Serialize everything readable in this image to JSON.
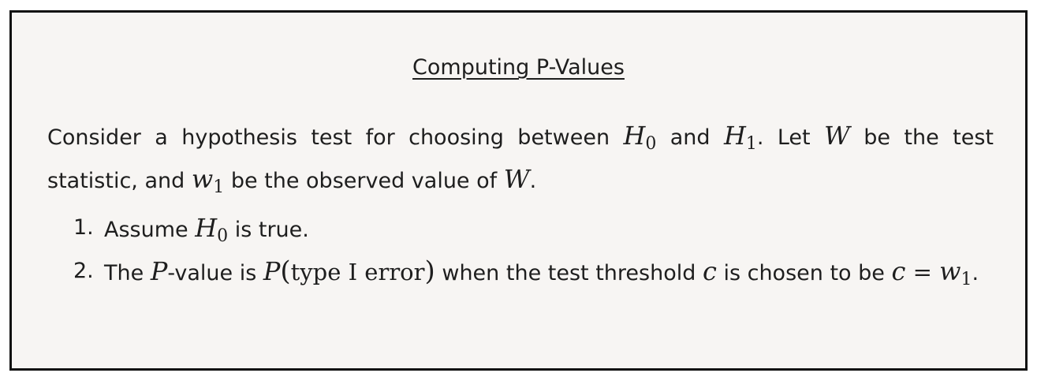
{
  "title": "Computing P-Values",
  "intro": {
    "t1": "Consider a hypothesis test for choosing between ",
    "h0_sym": "H",
    "h0_sub": "0",
    "t2": " and ",
    "h1_sym": "H",
    "h1_sub": "1",
    "t3": ". Let ",
    "w_sym": "W",
    "t4": " be the test statistic, and ",
    "w1_sym": "w",
    "w1_sub": "1",
    "t5": " be the observed value of ",
    "w_sym2": "W",
    "t6": "."
  },
  "steps": [
    {
      "number": "1.",
      "t1": "Assume ",
      "h0_sym": "H",
      "h0_sub": "0",
      "t2": " is true."
    },
    {
      "number": "2.",
      "t1": "The ",
      "p_sym": "P",
      "t2": "-value is ",
      "p_sym2": "P",
      "open_paren": "(",
      "type_text": "type I error",
      "close_paren": ")",
      "t3": " when the test threshold ",
      "c_sym": "c",
      "t4": " is chosen to be ",
      "eq_c": "c",
      "eq_sign": " = ",
      "eq_w": "w",
      "eq_sub": "1",
      "t5": "."
    }
  ]
}
